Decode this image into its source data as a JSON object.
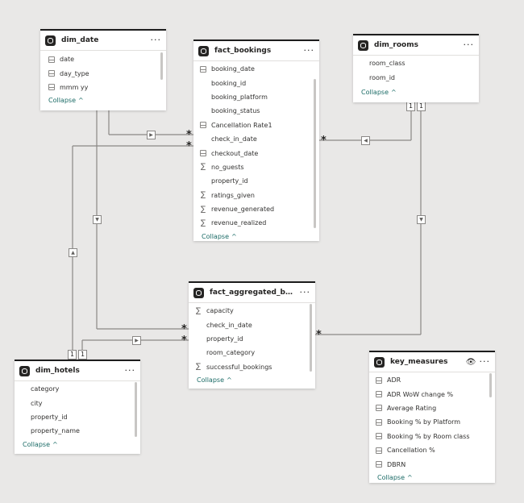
{
  "tables": {
    "dim_date": {
      "name": "dim_date",
      "fields": [
        "date",
        "day_type",
        "mmm yy"
      ],
      "icons": [
        "calendar-icon",
        "calculated-column-icon",
        "calendar-icon"
      ],
      "collapse_label": "Collapse"
    },
    "fact_bookings": {
      "name": "fact_bookings",
      "fields": [
        "booking_date",
        "booking_id",
        "booking_platform",
        "booking_status",
        "Cancellation Rate1",
        "check_in_date",
        "checkout_date",
        "no_guests",
        "property_id",
        "ratings_given",
        "revenue_generated",
        "revenue_realized"
      ],
      "icons": [
        "calendar-icon",
        "none",
        "none",
        "none",
        "calculated-column-icon",
        "none",
        "calendar-icon",
        "sigma-icon",
        "none",
        "sigma-icon",
        "sigma-icon",
        "sigma-icon"
      ],
      "collapse_label": "Collapse"
    },
    "dim_rooms": {
      "name": "dim_rooms",
      "fields": [
        "room_class",
        "room_id"
      ],
      "collapse_label": "Collapse"
    },
    "fact_aggregated_bookings": {
      "name": "fact_aggregated_booki...",
      "fields": [
        "capacity",
        "check_in_date",
        "property_id",
        "room_category",
        "successful_bookings"
      ],
      "icons": [
        "sigma-icon",
        "none",
        "none",
        "none",
        "sigma-icon"
      ],
      "collapse_label": "Collapse"
    },
    "dim_hotels": {
      "name": "dim_hotels",
      "fields": [
        "category",
        "city",
        "property_id",
        "property_name"
      ],
      "collapse_label": "Collapse"
    },
    "key_measures": {
      "name": "key_measures",
      "fields": [
        "ADR",
        "ADR WoW change %",
        "Average Rating",
        "Booking % by Platform",
        "Booking % by Room class",
        "Cancellation %",
        "DBRN"
      ],
      "collapse_label": "Collapse"
    }
  },
  "glyphs": {
    "more": "···",
    "one": "1",
    "many": "*",
    "sigma": "∑",
    "eye": "👁",
    "chevron_up": "^"
  }
}
